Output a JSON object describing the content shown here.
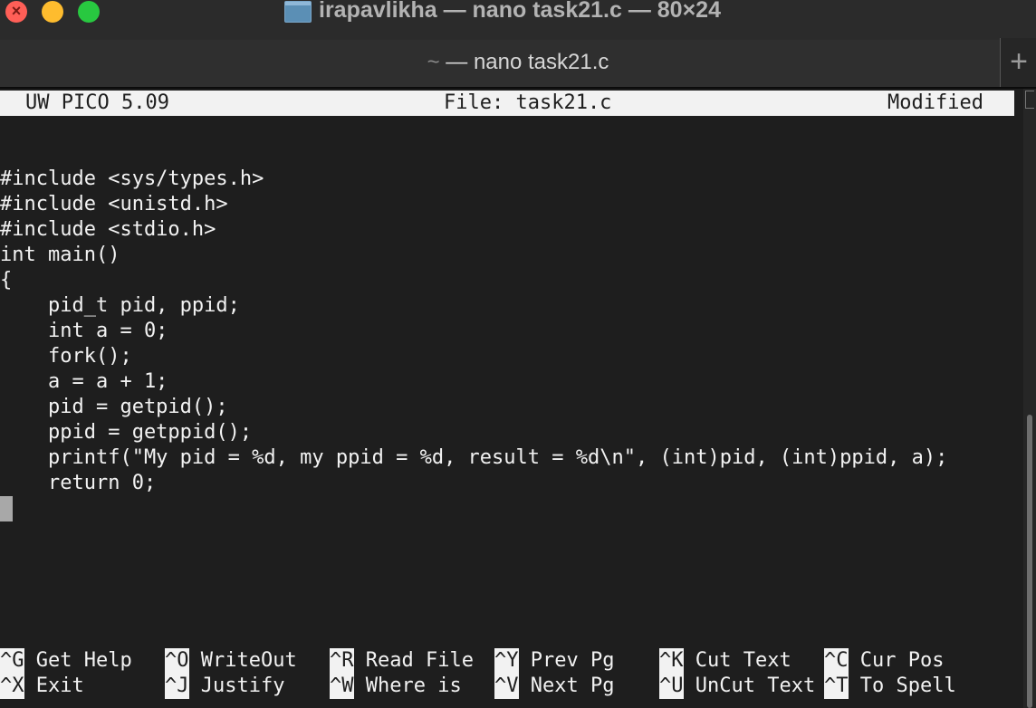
{
  "window": {
    "title": "irapavlikha — nano task21.c — 80×24",
    "traffic_lights": [
      "close",
      "minimize",
      "maximize"
    ],
    "colors": {
      "close": "#ff5f57",
      "minimize": "#febc2e",
      "maximize": "#28c840"
    }
  },
  "tab": {
    "tilde": "~",
    "title": " — nano task21.c",
    "new_tab_label": "+"
  },
  "nano": {
    "version": "UW PICO 5.09",
    "file": "File: task21.c",
    "status": "Modified"
  },
  "code_lines": [
    "",
    "#include <sys/types.h>",
    "#include <unistd.h>",
    "#include <stdio.h>",
    "int main()",
    "{",
    "    pid_t pid, ppid;",
    "    int a = 0;",
    "    fork();",
    "    a = a + 1;",
    "    pid = getpid();",
    "    ppid = getppid();",
    "    printf(\"My pid = %d, my ppid = %d, result = %d\\n\", (int)pid, (int)ppid, a);",
    "    return 0;",
    "}"
  ],
  "shortcuts": [
    {
      "key": "^G",
      "label": " Get Help"
    },
    {
      "key": "^O",
      "label": " WriteOut"
    },
    {
      "key": "^R",
      "label": " Read File"
    },
    {
      "key": "^Y",
      "label": " Prev Pg"
    },
    {
      "key": "^K",
      "label": " Cut Text"
    },
    {
      "key": "^C",
      "label": " Cur Pos"
    },
    {
      "key": "^X",
      "label": " Exit"
    },
    {
      "key": "^J",
      "label": " Justify"
    },
    {
      "key": "^W",
      "label": " Where is"
    },
    {
      "key": "^V",
      "label": " Next Pg"
    },
    {
      "key": "^U",
      "label": " UnCut Text"
    },
    {
      "key": "^T",
      "label": " To Spell"
    }
  ]
}
